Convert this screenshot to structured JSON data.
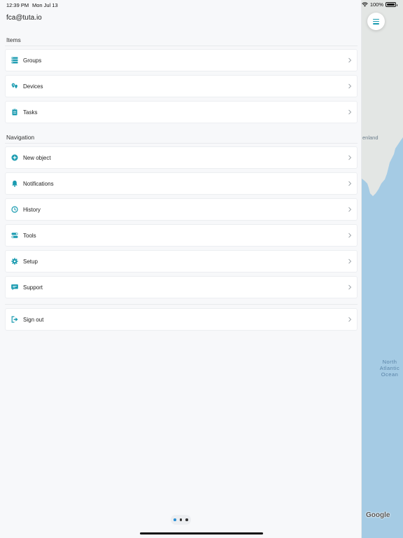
{
  "status_bar": {
    "time": "12:39 PM",
    "date": "Mon Jul 13",
    "battery": "100%"
  },
  "account": {
    "email": "fca@tuta.io"
  },
  "sections": {
    "items": {
      "title": "Items",
      "entries": [
        {
          "label": "Groups",
          "icon": "groups-list-icon"
        },
        {
          "label": "Devices",
          "icon": "devices-pins-icon"
        },
        {
          "label": "Tasks",
          "icon": "clipboard-icon"
        }
      ]
    },
    "navigation": {
      "title": "Navigation",
      "entries": [
        {
          "label": "New object",
          "icon": "plus-circle-icon"
        },
        {
          "label": "Notifications",
          "icon": "bell-icon"
        },
        {
          "label": "History",
          "icon": "clock-icon"
        },
        {
          "label": "Tools",
          "icon": "toggles-icon"
        },
        {
          "label": "Setup",
          "icon": "gear-icon"
        },
        {
          "label": "Support",
          "icon": "chat-bubble-icon"
        }
      ]
    },
    "account_actions": {
      "entries": [
        {
          "label": "Sign out",
          "icon": "sign-out-icon"
        }
      ]
    }
  },
  "map": {
    "land_label": "enland",
    "ocean_label_line1": "North",
    "ocean_label_line2": "Atlantic",
    "ocean_label_line3": "Ocean",
    "attribution": "Google"
  },
  "colors": {
    "accent": "#1a9bb0",
    "water": "#a5cbe4",
    "land": "#e3e6e4",
    "background": "#f7f8fa"
  }
}
